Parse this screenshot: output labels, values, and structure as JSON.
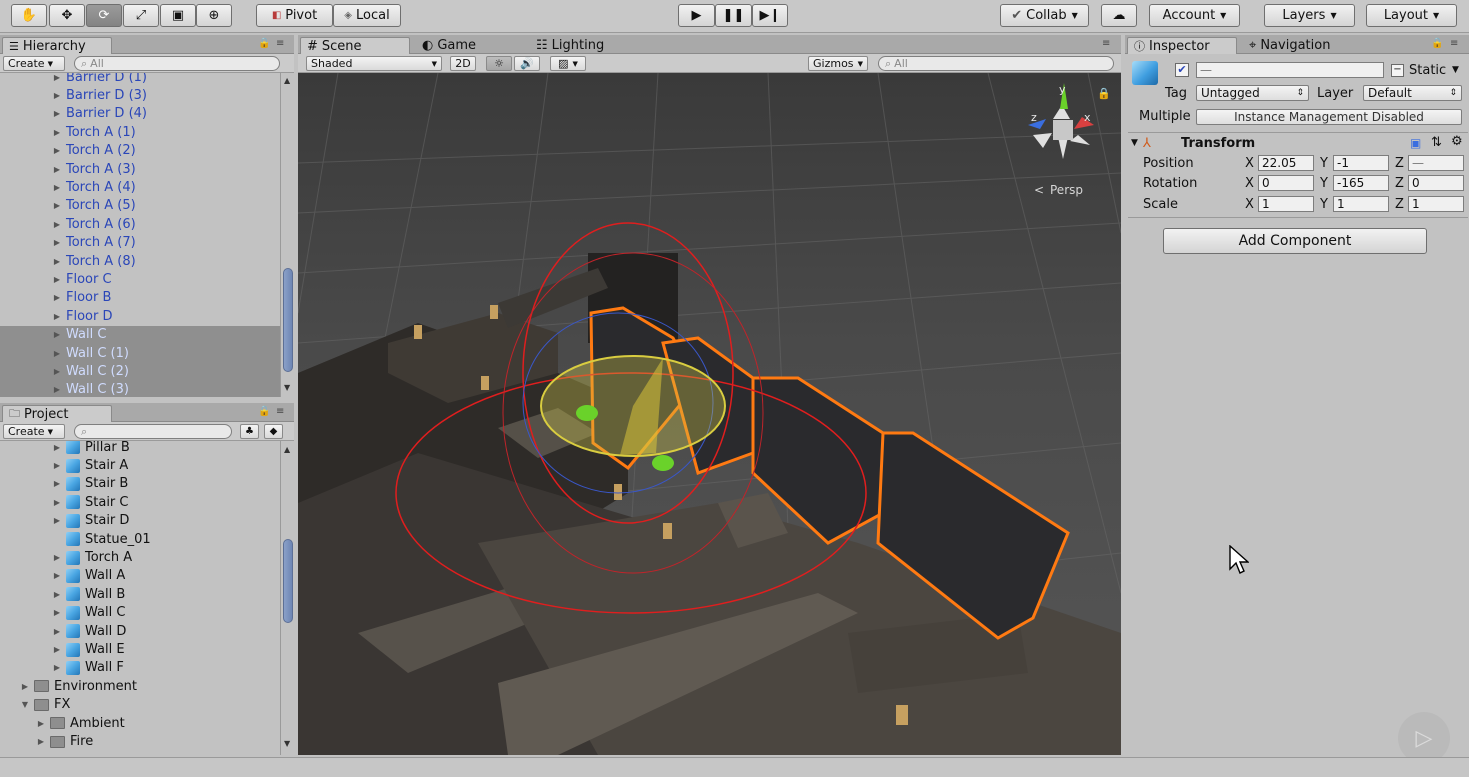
{
  "toolbar": {
    "pivot_label": "Pivot",
    "local_label": "Local",
    "collab_label": "Collab",
    "account_label": "Account",
    "layers_label": "Layers",
    "layout_label": "Layout"
  },
  "hierarchy": {
    "tab_label": "Hierarchy",
    "create_label": "Create",
    "search_placeholder": "All",
    "items": [
      {
        "label": "Barrier D (1)",
        "selected": false
      },
      {
        "label": "Barrier D (3)",
        "selected": false
      },
      {
        "label": "Barrier D (4)",
        "selected": false
      },
      {
        "label": "Torch A (1)",
        "selected": false
      },
      {
        "label": "Torch A (2)",
        "selected": false
      },
      {
        "label": "Torch A (3)",
        "selected": false
      },
      {
        "label": "Torch A (4)",
        "selected": false
      },
      {
        "label": "Torch A (5)",
        "selected": false
      },
      {
        "label": "Torch A (6)",
        "selected": false
      },
      {
        "label": "Torch A (7)",
        "selected": false
      },
      {
        "label": "Torch A (8)",
        "selected": false
      },
      {
        "label": "Floor C",
        "selected": false
      },
      {
        "label": "Floor B",
        "selected": false
      },
      {
        "label": "Floor D",
        "selected": false
      },
      {
        "label": "Wall C",
        "selected": true
      },
      {
        "label": "Wall C (1)",
        "selected": true
      },
      {
        "label": "Wall C (2)",
        "selected": true
      },
      {
        "label": "Wall C (3)",
        "selected": true
      }
    ]
  },
  "project": {
    "tab_label": "Project",
    "create_label": "Create",
    "items": [
      {
        "label": "Pillar B",
        "kind": "prefab",
        "expand": true
      },
      {
        "label": "Stair A",
        "kind": "prefab",
        "expand": true
      },
      {
        "label": "Stair B",
        "kind": "prefab",
        "expand": true
      },
      {
        "label": "Stair C",
        "kind": "prefab",
        "expand": true
      },
      {
        "label": "Stair D",
        "kind": "prefab",
        "expand": true
      },
      {
        "label": "Statue_01",
        "kind": "prefab",
        "expand": false
      },
      {
        "label": "Torch A",
        "kind": "prefab",
        "expand": true
      },
      {
        "label": "Wall A",
        "kind": "prefab",
        "expand": true
      },
      {
        "label": "Wall B",
        "kind": "prefab",
        "expand": true
      },
      {
        "label": "Wall C",
        "kind": "prefab",
        "expand": true
      },
      {
        "label": "Wall D",
        "kind": "prefab",
        "expand": true
      },
      {
        "label": "Wall E",
        "kind": "prefab",
        "expand": true
      },
      {
        "label": "Wall F",
        "kind": "prefab",
        "expand": true
      },
      {
        "label": "Environment",
        "kind": "folder",
        "expand": true
      },
      {
        "label": "FX",
        "kind": "folder-open",
        "expand": true
      },
      {
        "label": "Ambient",
        "kind": "folder",
        "expand": true
      },
      {
        "label": "Fire",
        "kind": "folder",
        "expand": true
      }
    ]
  },
  "scene": {
    "tabs": {
      "scene": "Scene",
      "game": "Game",
      "lighting": "Lighting"
    },
    "shading_label": "Shaded",
    "mode_2d_label": "2D",
    "gizmos_label": "Gizmos",
    "search_placeholder": "All",
    "persp_label": "Persp",
    "axis_labels": {
      "x": "x",
      "y": "y",
      "z": "z"
    }
  },
  "inspector": {
    "tabs": {
      "inspector": "Inspector",
      "navigation": "Navigation"
    },
    "name_value": "—",
    "static_label": "Static",
    "tag_label": "Tag",
    "tag_value": "Untagged",
    "layer_label": "Layer",
    "layer_value": "Default",
    "multiple_label": "Multiple",
    "instance_label": "Instance Management Disabled",
    "transform": {
      "title": "Transform",
      "position_label": "Position",
      "rotation_label": "Rotation",
      "scale_label": "Scale",
      "axis_x": "X",
      "axis_y": "Y",
      "axis_z": "Z",
      "position": {
        "x": "22.05",
        "y": "-1",
        "z": "—"
      },
      "rotation": {
        "x": "0",
        "y": "-165",
        "z": "0"
      },
      "scale": {
        "x": "1",
        "y": "1",
        "z": "1"
      }
    },
    "add_component_label": "Add Component"
  },
  "colors": {
    "selection_outline": "#ff7a12",
    "rotate_ring": "#e01e1e",
    "hierarchy_text": "#2a46b8"
  }
}
